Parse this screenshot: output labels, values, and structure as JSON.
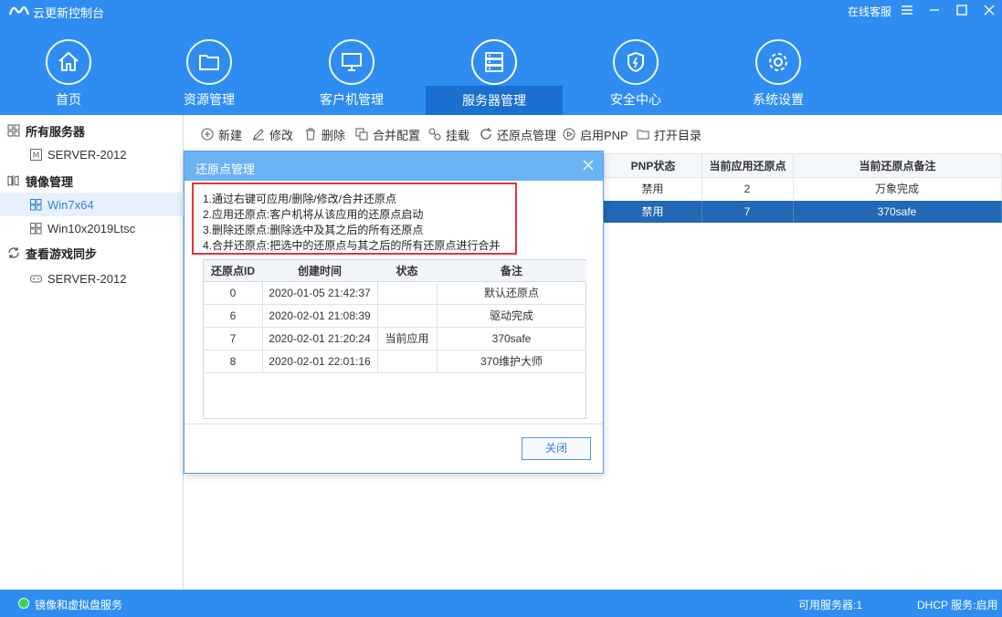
{
  "app": {
    "title": "云更新控制台",
    "online_support": "在线客服"
  },
  "nav": [
    {
      "label": "首页",
      "icon": "home-icon"
    },
    {
      "label": "资源管理",
      "icon": "folder-icon"
    },
    {
      "label": "客户机管理",
      "icon": "monitor-icon"
    },
    {
      "label": "服务器管理",
      "icon": "server-icon"
    },
    {
      "label": "安全中心",
      "icon": "shield-icon"
    },
    {
      "label": "系统设置",
      "icon": "gear-icon"
    }
  ],
  "sidebar": {
    "groups": [
      {
        "label": "所有服务器",
        "items": [
          {
            "label": "SERVER-2012"
          }
        ]
      },
      {
        "label": "镜像管理",
        "items": [
          {
            "label": "Win7x64"
          },
          {
            "label": "Win10x2019Ltsc"
          }
        ]
      },
      {
        "label": "查看游戏同步",
        "items": [
          {
            "label": "SERVER-2012"
          }
        ]
      }
    ]
  },
  "toolbar": {
    "new": "新建",
    "edit": "修改",
    "delete": "删除",
    "merge_config": "合并配置",
    "mount": "挂载",
    "restore_mgmt": "还原点管理",
    "enable_pnp": "启用PNP",
    "open_dir": "打开目录"
  },
  "bg_table": {
    "headers": [
      "PNP状态",
      "当前应用还原点",
      "当前还原点备注"
    ],
    "rows": [
      [
        "禁用",
        "2",
        "万象完成"
      ],
      [
        "禁用",
        "7",
        "370safe"
      ]
    ]
  },
  "dialog": {
    "title": "还原点管理",
    "info": [
      "1.通过右键可应用/删除/修改/合并还原点",
      "2.应用还原点:客户机将从该应用的还原点启动",
      "3.删除还原点:删除选中及其之后的所有还原点",
      "4.合并还原点:把选中的还原点与其之后的所有还原点进行合并"
    ],
    "headers": [
      "还原点ID",
      "创建时间",
      "状态",
      "备注"
    ],
    "rows": [
      [
        "0",
        "2020-01-05 21:42:37",
        "",
        "默认还原点"
      ],
      [
        "6",
        "2020-02-01 21:08:39",
        "",
        "驱动完成"
      ],
      [
        "7",
        "2020-02-01 21:20:24",
        "当前应用",
        "370safe"
      ],
      [
        "8",
        "2020-02-01 22:01:16",
        "",
        "370维护大师"
      ]
    ],
    "close_label": "关闭"
  },
  "statusbar": {
    "service": "镜像和虚拟盘服务",
    "servers": "可用服务器:1",
    "dhcp": "DHCP 服务:启用"
  },
  "colors": {
    "header": "#2f8df2",
    "nav_active": "#1a6fd0",
    "dialog_title": "#6bb3f5",
    "selected_row": "#2268b5",
    "info_border": "#e5323a",
    "status_ok": "#3bd34a"
  }
}
